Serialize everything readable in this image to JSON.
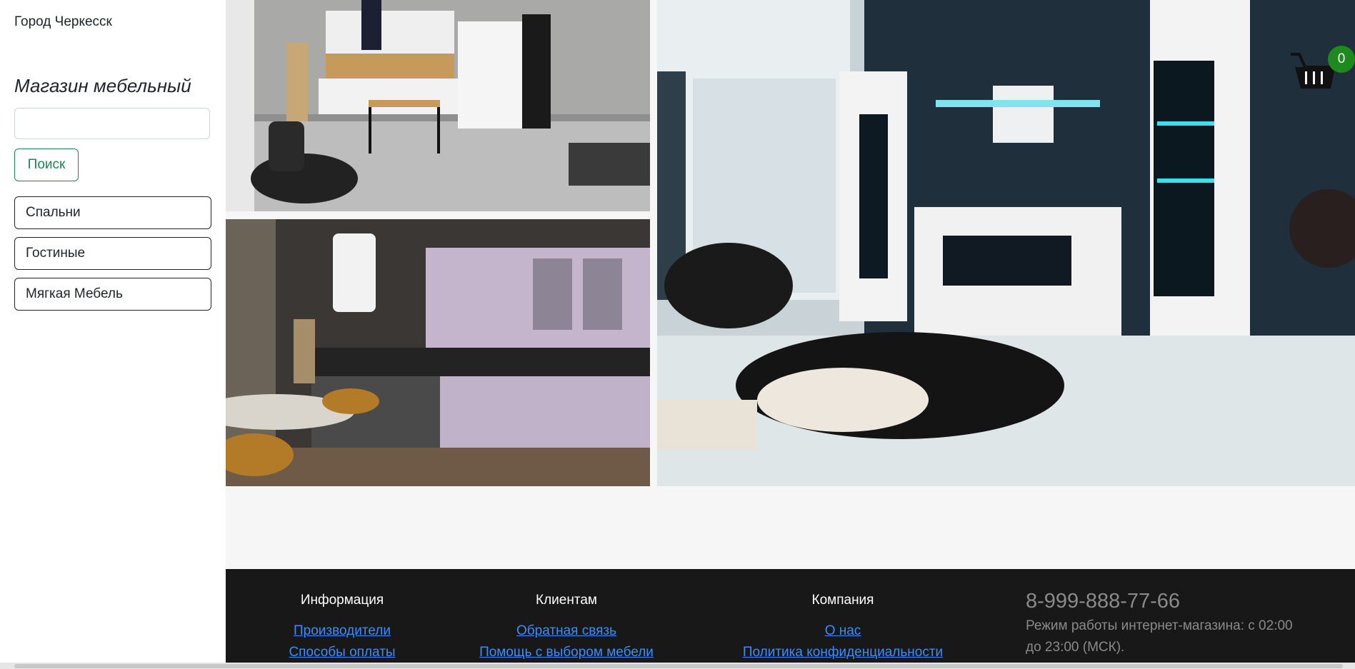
{
  "sidebar": {
    "city": "Город Черкесск",
    "shop_title": "Магазин мебельный",
    "search": {
      "placeholder": "",
      "value": "",
      "button_label": "Поиск"
    },
    "categories": [
      {
        "label": "Спальни"
      },
      {
        "label": "Гостиные"
      },
      {
        "label": "Мягкая Мебель"
      }
    ]
  },
  "cart": {
    "count": "0",
    "icon": "basket-icon",
    "badge_color": "#1e8a1e"
  },
  "footer": {
    "columns": [
      {
        "title": "Информация",
        "links": [
          "Производители",
          "Способы оплаты"
        ]
      },
      {
        "title": "Клиентам",
        "links": [
          "Обратная связь",
          "Помощь с выбором мебели"
        ]
      },
      {
        "title": "Компания",
        "links": [
          "О нас",
          "Политика конфиденциальности"
        ]
      }
    ],
    "phone": "8-999-888-77-66",
    "hours": "Режим работы интернет-магазина: с 02:00 до 23:00 (МСК)."
  },
  "colors": {
    "accent": "#198754",
    "link": "#3b8cff",
    "footer_bg": "#181818"
  }
}
